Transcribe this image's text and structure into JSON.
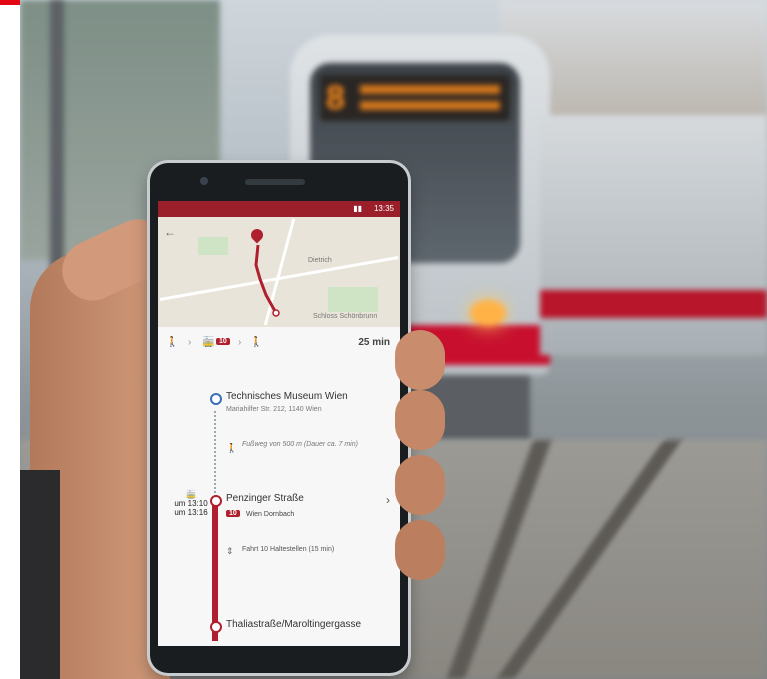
{
  "colors": {
    "accent": "#e30613",
    "tram_red": "#c8102e",
    "route_red": "#b01f2e"
  },
  "tram_display": {
    "line_number": "8"
  },
  "phone": {
    "status_time": "13:35",
    "back_icon": "arrow-left-icon",
    "map_labels": [
      "Dietrich",
      "Schloss Schönbrunn"
    ],
    "summary": {
      "line": "10",
      "duration": "25 min"
    },
    "steps": {
      "origin_title": "Technisches Museum Wien",
      "origin_address": "Mariahilfer Str. 212, 1140 Wien",
      "walk_text": "Fußweg von 500 m (Dauer ca. 7 min)",
      "time_from": "um 13:10",
      "time_to": "um 13:16",
      "boarding_stop": "Penzinger Straße",
      "line_badge": "10",
      "direction": "Wien Dornbach",
      "ride_text": "Fahrt 10 Haltestellen (15 min)",
      "destination": "Thaliastraße/Maroltingergasse"
    }
  }
}
